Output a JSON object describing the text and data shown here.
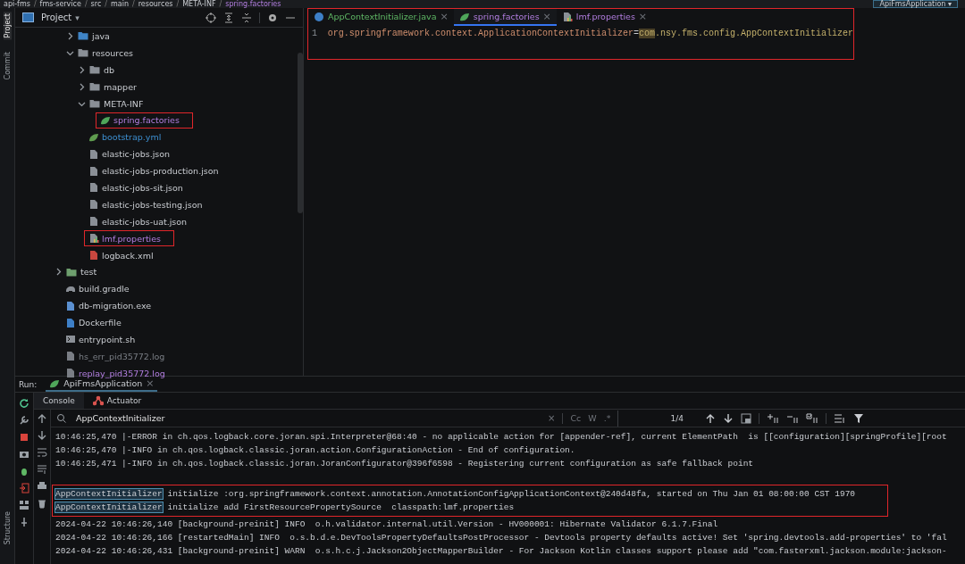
{
  "breadcrumb": [
    {
      "label": "api-fms"
    },
    {
      "separator": "/",
      "label": "fms-service"
    },
    {
      "separator": "/",
      "label": "src"
    },
    {
      "separator": "/",
      "label": "main"
    },
    {
      "separator": "/",
      "label": "resources"
    },
    {
      "separator": "/",
      "label": "META-INF"
    },
    {
      "separator": "/",
      "label": "spring.factories"
    }
  ],
  "run_config": {
    "label": "ApiFmsApplication",
    "caret": "▾"
  },
  "side_tabs": [
    {
      "label": "Project",
      "selected": true
    },
    {
      "label": "Commit",
      "selected": false
    }
  ],
  "bottom_side_tabs": [
    {
      "label": "Structure",
      "selected": false
    }
  ],
  "project_panel": {
    "title": "Project",
    "caret": "▾"
  },
  "tree": {
    "nested_items": [
      {
        "label": "java",
        "kind": "source-folder",
        "expanded": false
      },
      {
        "label": "resources",
        "kind": "resources-folder",
        "expanded": true,
        "children": [
          {
            "label": "db",
            "kind": "folder",
            "expanded": false
          },
          {
            "label": "mapper",
            "kind": "folder",
            "expanded": false
          },
          {
            "label": "META-INF",
            "kind": "folder",
            "expanded": true,
            "children": [
              {
                "label": "spring.factories",
                "kind": "spring",
                "modified": false,
                "untracked": true,
                "ignored": false,
                "annotated": true
              }
            ]
          },
          {
            "label": "bootstrap.yml",
            "kind": "yaml",
            "modified": true,
            "untracked": false,
            "ignored": false,
            "annotated": false
          },
          {
            "label": "elastic-jobs.json",
            "kind": "json",
            "modified": false,
            "untracked": false,
            "ignored": false,
            "annotated": false
          },
          {
            "label": "elastic-jobs-production.json",
            "kind": "json",
            "modified": false,
            "untracked": false,
            "ignored": false,
            "annotated": false
          },
          {
            "label": "elastic-jobs-sit.json",
            "kind": "json",
            "modified": false,
            "untracked": false,
            "ignored": false,
            "annotated": false
          },
          {
            "label": "elastic-jobs-testing.json",
            "kind": "json",
            "modified": false,
            "untracked": false,
            "ignored": false,
            "annotated": false
          },
          {
            "label": "elastic-jobs-uat.json",
            "kind": "json",
            "modified": false,
            "untracked": false,
            "ignored": false,
            "annotated": false
          },
          {
            "label": "lmf.properties",
            "kind": "properties",
            "modified": false,
            "untracked": true,
            "ignored": false,
            "annotated": true
          },
          {
            "label": "logback.xml",
            "kind": "xml",
            "modified": false,
            "untracked": false,
            "ignored": false,
            "annotated": false
          }
        ]
      }
    ],
    "items": [
      {
        "label": "test",
        "kind": "test-folder",
        "expanded": false
      },
      {
        "label": "build.gradle",
        "kind": "gradle",
        "modified": false,
        "untracked": false,
        "ignored": false,
        "annotated": false
      },
      {
        "label": "db-migration.exe",
        "kind": "exe",
        "modified": false,
        "untracked": false,
        "ignored": false,
        "annotated": false
      },
      {
        "label": "Dockerfile",
        "kind": "docker",
        "modified": false,
        "untracked": false,
        "ignored": false,
        "annotated": false
      },
      {
        "label": "entrypoint.sh",
        "kind": "shell",
        "modified": false,
        "untracked": false,
        "ignored": false,
        "annotated": false
      },
      {
        "label": "hs_err_pid35772.log",
        "kind": "log",
        "modified": false,
        "untracked": false,
        "ignored": true,
        "annotated": false
      },
      {
        "label": "replay_pid35772.log",
        "kind": "log",
        "modified": false,
        "untracked": true,
        "ignored": false,
        "annotated": false
      }
    ]
  },
  "editor": {
    "annotated": true,
    "tabs": [
      {
        "label": "AppContextInitializer.java",
        "kind": "java-class",
        "added": true,
        "untracked": false,
        "selected": false,
        "close": "×"
      },
      {
        "label": "spring.factories",
        "kind": "spring",
        "added": false,
        "untracked": true,
        "selected": true,
        "close": "×"
      },
      {
        "label": "lmf.properties",
        "kind": "properties",
        "added": false,
        "untracked": true,
        "selected": false,
        "close": "×"
      }
    ],
    "lines": [
      {
        "number": "1",
        "key": "org.springframework.context.ApplicationContextInitializer",
        "separator": "=",
        "value": [
          {
            "text": "com",
            "highlighted": true
          },
          {
            "text": ".nsy.fms.config.AppContextInitializer",
            "highlighted": false
          }
        ]
      }
    ]
  },
  "run_panel": {
    "label": "Run:",
    "tab": "ApiFmsApplication",
    "tab_close": "×",
    "tabs": [
      {
        "label": "Console",
        "kind": "plain",
        "selected": true
      },
      {
        "label": "Actuator",
        "kind": "actuator",
        "selected": false
      }
    ],
    "search": {
      "value": "AppContextInitializer",
      "clear": "×",
      "options": [
        "Cc",
        "W",
        ".*"
      ],
      "match_count": "1/4"
    },
    "lines": [
      {
        "kind": "text",
        "annotated": false,
        "parts": [
          {
            "text": "10:46:25,470 |-ERROR in ch.qos.logback.core.joran.spi.Interpreter@68:40 - no applicable action for [appender-ref], current ElementPath  is [[configuration][springProfile][root",
            "highlighted": false
          }
        ]
      },
      {
        "kind": "text",
        "annotated": false,
        "parts": [
          {
            "text": "10:46:25,470 |-INFO in ch.qos.logback.classic.joran.action.ConfigurationAction - End of configuration.",
            "highlighted": false
          }
        ]
      },
      {
        "kind": "text",
        "annotated": false,
        "parts": [
          {
            "text": "10:46:25,471 |-INFO in ch.qos.logback.classic.joran.JoranConfigurator@396f6598 - Registering current configuration as safe fallback point",
            "highlighted": false
          }
        ]
      },
      {
        "kind": "blank",
        "annotated": false
      },
      {
        "kind": "text",
        "annotated": true,
        "parts": [
          {
            "text": "AppContextInitializer",
            "highlighted": true
          },
          {
            "text": " initialize :org.springframework.context.annotation.AnnotationConfigApplicationContext@240d48fa, started on Thu Jan 01 08:00:00 CST 1970",
            "highlighted": false
          }
        ]
      },
      {
        "kind": "text",
        "annotated": true,
        "parts": [
          {
            "text": "AppContextInitializer",
            "highlighted": true
          },
          {
            "text": " initialize add FirstResourcePropertySource  classpath:lmf.properties",
            "highlighted": false
          }
        ]
      },
      {
        "kind": "text",
        "annotated": false,
        "parts": [
          {
            "text": "2024-04-22 10:46:26,140 [background-preinit] INFO  o.h.validator.internal.util.Version - HV000001: Hibernate Validator 6.1.7.Final",
            "highlighted": false
          }
        ]
      },
      {
        "kind": "text",
        "annotated": false,
        "parts": [
          {
            "text": "2024-04-22 10:46:26,166 [restartedMain] INFO  o.s.b.d.e.DevToolsPropertyDefaultsPostProcessor - Devtools property defaults active! Set 'spring.devtools.add-properties' to 'fal",
            "highlighted": false
          }
        ]
      },
      {
        "kind": "text",
        "annotated": false,
        "parts": [
          {
            "text": "2024-04-22 10:46:26,431 [background-preinit] WARN  o.s.h.c.j.Jackson2ObjectMapperBuilder - For Jackson Kotlin classes support please add \"com.fasterxml.jackson.module:jackson-",
            "highlighted": false
          }
        ]
      }
    ]
  }
}
